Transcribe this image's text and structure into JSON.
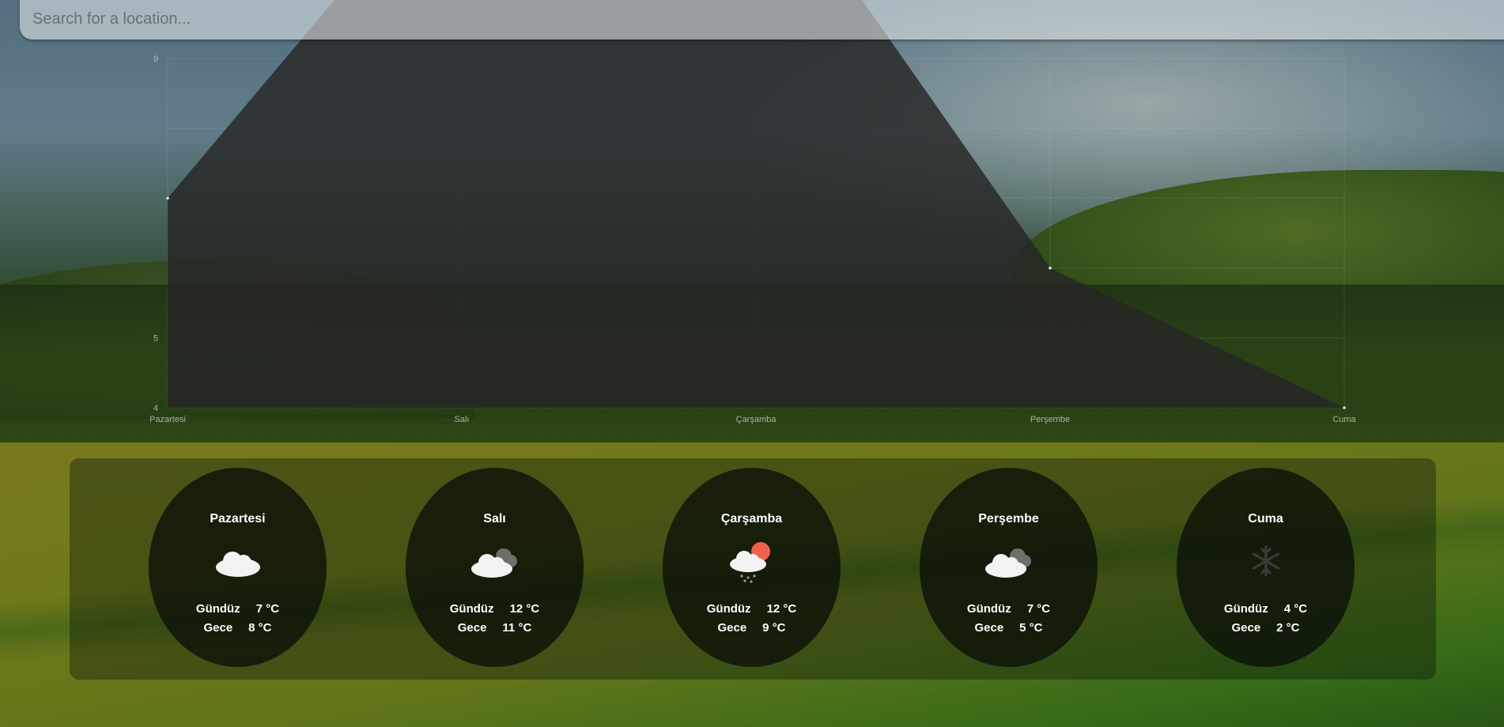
{
  "search": {
    "placeholder": "Search for a location..."
  },
  "colors": {
    "chart_fill": "#262626",
    "chart_point": "#c8e6f5",
    "card_bg": "#0a1008"
  },
  "chart_data": {
    "type": "area",
    "categories": [
      "Pazartesi",
      "Salı",
      "Çarşamba",
      "Perşembe",
      "Cuma"
    ],
    "series": [
      {
        "values": [
          7,
          12,
          12,
          6,
          4
        ]
      }
    ],
    "yticks": [
      4,
      5,
      9
    ],
    "ylim": [
      4,
      9
    ],
    "grid": true
  },
  "forecast": {
    "day_label": "Gündüz",
    "night_label": "Gece",
    "days": [
      {
        "name": "Pazartesi",
        "icon": "cloud-icon",
        "day_temp": "7 °C",
        "night_temp": "8 °C"
      },
      {
        "name": "Salı",
        "icon": "dark-clouds-icon",
        "day_temp": "12 °C",
        "night_temp": "11 °C"
      },
      {
        "name": "Çarşamba",
        "icon": "sun-cloud-rain-icon",
        "day_temp": "12 °C",
        "night_temp": "9 °C"
      },
      {
        "name": "Perşembe",
        "icon": "dark-clouds-icon",
        "day_temp": "7 °C",
        "night_temp": "5 °C"
      },
      {
        "name": "Cuma",
        "icon": "snowflake-icon",
        "day_temp": "4 °C",
        "night_temp": "2 °C"
      }
    ]
  }
}
